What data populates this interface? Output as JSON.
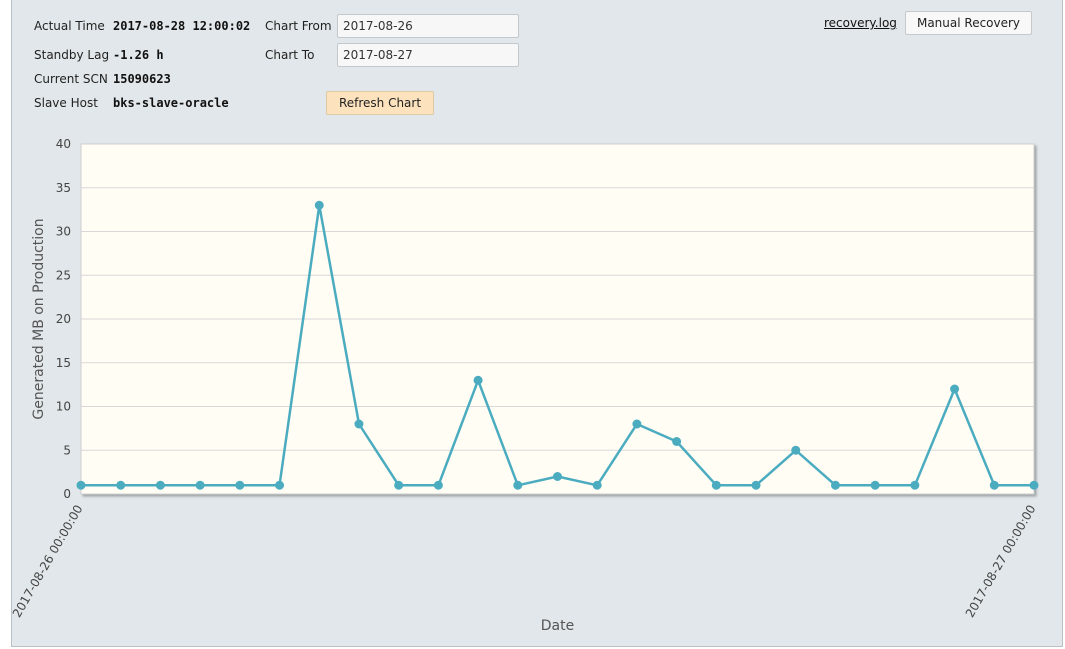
{
  "info": {
    "actual_time_label": "Actual Time",
    "actual_time_value": "2017-08-28 12:00:02",
    "standby_lag_label": "Standby Lag",
    "standby_lag_value": "-1.26 h",
    "current_scn_label": "Current SCN",
    "current_scn_value": "15090623",
    "slave_host_label": "Slave Host",
    "slave_host_value": "bks-slave-oracle"
  },
  "controls": {
    "chart_from_label": "Chart From",
    "chart_from_value": "2017-08-26",
    "chart_to_label": "Chart To",
    "chart_to_value": "2017-08-27",
    "refresh_label": "Refresh Chart",
    "recovery_log_link": "recovery.log",
    "manual_recovery_label": "Manual Recovery"
  },
  "chart_data": {
    "type": "line",
    "xlabel": "Date",
    "ylabel": "Generated MB on Production",
    "ylim": [
      0,
      40
    ],
    "yticks": [
      0,
      5,
      10,
      15,
      20,
      25,
      30,
      35,
      40
    ],
    "xtick_labels": [
      "2017-08-26 00:00:00",
      "2017-08-27 00:00:00"
    ],
    "x": [
      "2017-08-26 00:00",
      "2017-08-26 01:00",
      "2017-08-26 02:00",
      "2017-08-26 03:00",
      "2017-08-26 04:00",
      "2017-08-26 05:00",
      "2017-08-26 06:00",
      "2017-08-26 07:00",
      "2017-08-26 08:00",
      "2017-08-26 09:00",
      "2017-08-26 10:00",
      "2017-08-26 11:00",
      "2017-08-26 12:00",
      "2017-08-26 13:00",
      "2017-08-26 14:00",
      "2017-08-26 15:00",
      "2017-08-26 16:00",
      "2017-08-26 17:00",
      "2017-08-26 18:00",
      "2017-08-26 19:00",
      "2017-08-26 20:00",
      "2017-08-26 21:00",
      "2017-08-26 22:00",
      "2017-08-26 23:00",
      "2017-08-27 00:00"
    ],
    "values": [
      1,
      1,
      1,
      1,
      1,
      1,
      33,
      8,
      1,
      1,
      13,
      1,
      2,
      1,
      8,
      6,
      1,
      1,
      5,
      1,
      1,
      1,
      12,
      1,
      1
    ],
    "grid": true,
    "colors": {
      "line": "#4bacc0",
      "plot_background": "#fffdf4",
      "grid": "#d8d8d8"
    }
  }
}
